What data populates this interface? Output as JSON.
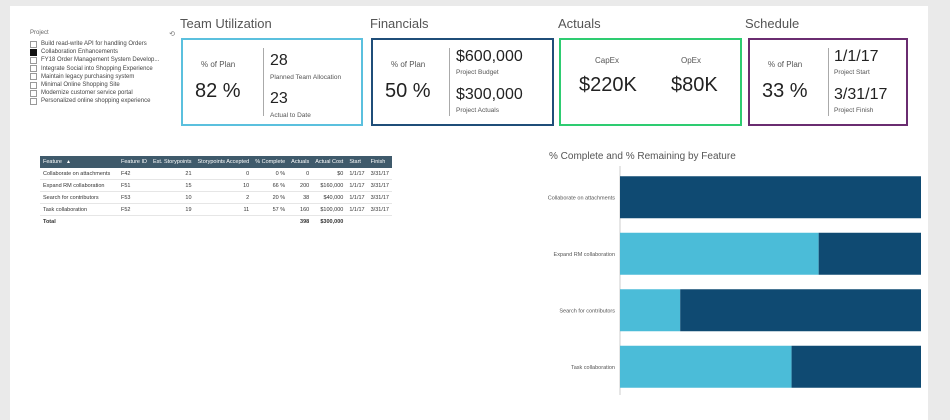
{
  "slicer": {
    "title": "Project",
    "items": [
      {
        "label": "Build read-write API for handling Orders",
        "checked": false
      },
      {
        "label": "Collaboration Enhancements",
        "checked": true
      },
      {
        "label": "FY18 Order Management System Develop...",
        "checked": false
      },
      {
        "label": "Integrate Social into Shopping Experience",
        "checked": false
      },
      {
        "label": "Maintain legacy purchasing system",
        "checked": false
      },
      {
        "label": "Minimal Online Shopping Site",
        "checked": false
      },
      {
        "label": "Modernize customer service portal",
        "checked": false
      },
      {
        "label": "Personalized online shopping experience",
        "checked": false
      }
    ]
  },
  "team_utilization": {
    "title": "Team Utilization",
    "color": "#5bc0de",
    "pct_label": "% of Plan",
    "pct_value": "82 %",
    "planned_value": "28",
    "planned_label": "Planned Team Allocation",
    "actual_value": "23",
    "actual_label": "Actual to Date"
  },
  "financials": {
    "title": "Financials",
    "color": "#1f4e79",
    "pct_label": "% of Plan",
    "pct_value": "50 %",
    "budget_value": "$600,000",
    "budget_label": "Project Budget",
    "actuals_value": "$300,000",
    "actuals_label": "Project Actuals"
  },
  "actuals": {
    "title": "Actuals",
    "color": "#2ecc71",
    "capex_label": "CapEx",
    "capex_value": "$220K",
    "opex_label": "OpEx",
    "opex_value": "$80K"
  },
  "schedule": {
    "title": "Schedule",
    "color": "#6a2c70",
    "pct_label": "% of Plan",
    "pct_value": "33 %",
    "start_value": "1/1/17",
    "start_label": "Project Start",
    "finish_value": "3/31/17",
    "finish_label": "Project Finish"
  },
  "table": {
    "headers": [
      "Feature",
      "Feature ID",
      "Est. Storypoints",
      "Storypoints Accepted",
      "% Complete",
      "Actuals",
      "Actual Cost",
      "Start",
      "Finish"
    ],
    "rows": [
      [
        "Collaborate on attachments",
        "F42",
        "21",
        "0",
        "0 %",
        "0",
        "$0",
        "1/1/17",
        "3/31/17"
      ],
      [
        "Expand RM collaboration",
        "F51",
        "15",
        "10",
        "66 %",
        "200",
        "$160,000",
        "1/1/17",
        "3/31/17"
      ],
      [
        "Search for contributors",
        "F53",
        "10",
        "2",
        "20 %",
        "38",
        "$40,000",
        "1/1/17",
        "3/31/17"
      ],
      [
        "Task collaboration",
        "F52",
        "19",
        "11",
        "57 %",
        "160",
        "$100,000",
        "1/1/17",
        "3/31/17"
      ]
    ],
    "total": [
      "Total",
      "",
      "",
      "",
      "",
      "398",
      "$300,000",
      "",
      ""
    ]
  },
  "chart_data": {
    "type": "bar",
    "orientation": "horizontal",
    "stacked": true,
    "title": "% Complete and % Remaining by Feature",
    "categories": [
      "Collaborate on attachments",
      "Expand RM collaboration",
      "Search for contributors",
      "Task collaboration"
    ],
    "series": [
      {
        "values": [
          0,
          66,
          20,
          57
        ],
        "color": "#4bbcd8"
      },
      {
        "values": [
          100,
          34,
          80,
          43
        ],
        "color": "#0f4a72"
      }
    ],
    "xlim": [
      0,
      100
    ],
    "grid": false,
    "legend": "none"
  }
}
